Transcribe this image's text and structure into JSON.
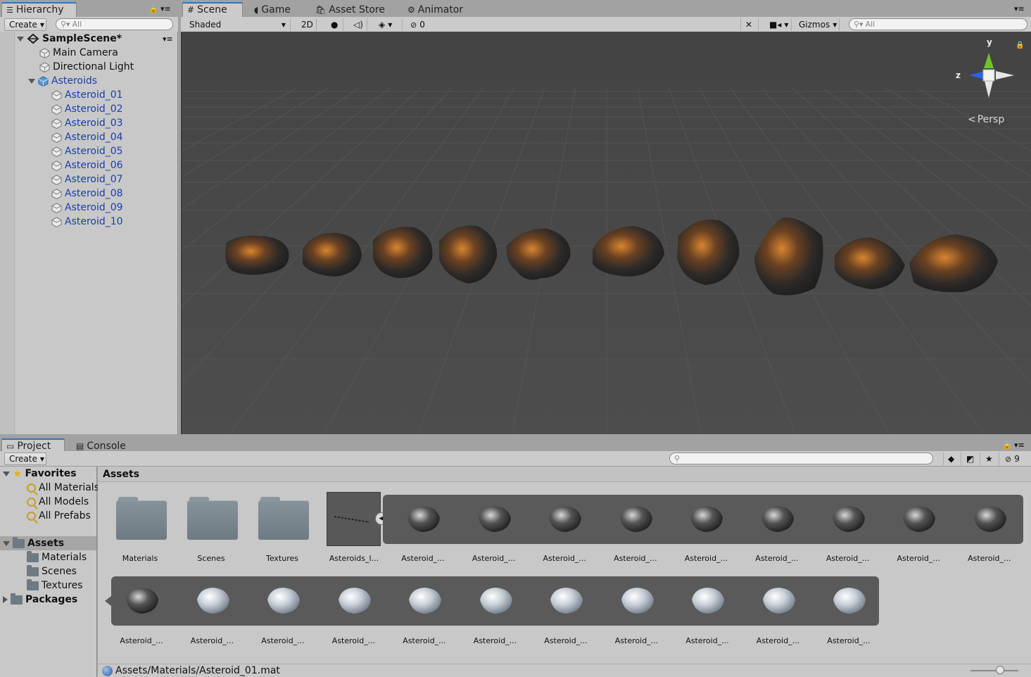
{
  "hierarchy": {
    "tab_label": "Hierarchy",
    "create_label": "Create",
    "search_placeholder": "All",
    "scene_name": "SampleScene*",
    "objects": [
      "Main Camera",
      "Directional Light"
    ],
    "group_name": "Asteroids",
    "children": [
      "Asteroid_01",
      "Asteroid_02",
      "Asteroid_03",
      "Asteroid_04",
      "Asteroid_05",
      "Asteroid_06",
      "Asteroid_07",
      "Asteroid_08",
      "Asteroid_09",
      "Asteroid_10"
    ]
  },
  "scene": {
    "tabs": [
      "Scene",
      "Game",
      "Asset Store",
      "Animator"
    ],
    "shading_mode": "Shaded",
    "mode_2d": "2D",
    "hidden_count": "0",
    "gizmos_label": "Gizmos",
    "search_placeholder": "All",
    "projection": "Persp",
    "axis_y": "y",
    "axis_z": "z"
  },
  "project": {
    "tabs": [
      "Project",
      "Console"
    ],
    "create_label": "Create",
    "hidden_count": "9",
    "favorites_label": "Favorites",
    "favorites": [
      "All Materials",
      "All Models",
      "All Prefabs"
    ],
    "assets_label": "Assets",
    "asset_folders": [
      "Materials",
      "Scenes",
      "Textures"
    ],
    "packages_label": "Packages",
    "breadcrumb": "Assets",
    "grid_folders": [
      "Materials",
      "Scenes",
      "Textures"
    ],
    "model_label": "Asteroids_l...",
    "row1_labels": [
      "Asteroid_...",
      "Asteroid_...",
      "Asteroid_...",
      "Asteroid_...",
      "Asteroid_...",
      "Asteroid_...",
      "Asteroid_...",
      "Asteroid_...",
      "Asteroid_..."
    ],
    "row2_labels": [
      "Asteroid_...",
      "Asteroid_...",
      "Asteroid_...",
      "Asteroid_...",
      "Asteroid_...",
      "Asteroid_...",
      "Asteroid_...",
      "Asteroid_...",
      "Asteroid_...",
      "Asteroid_...",
      "Asteroid_..."
    ],
    "status_path": "Assets/Materials/Asteroid_01.mat"
  },
  "colors": {
    "accent": "#3a72b0",
    "selection": "#1a3fa8",
    "asteroid_orange": "#c8741e",
    "axis_y": "#6bc42a",
    "axis_z": "#2f64e0"
  }
}
